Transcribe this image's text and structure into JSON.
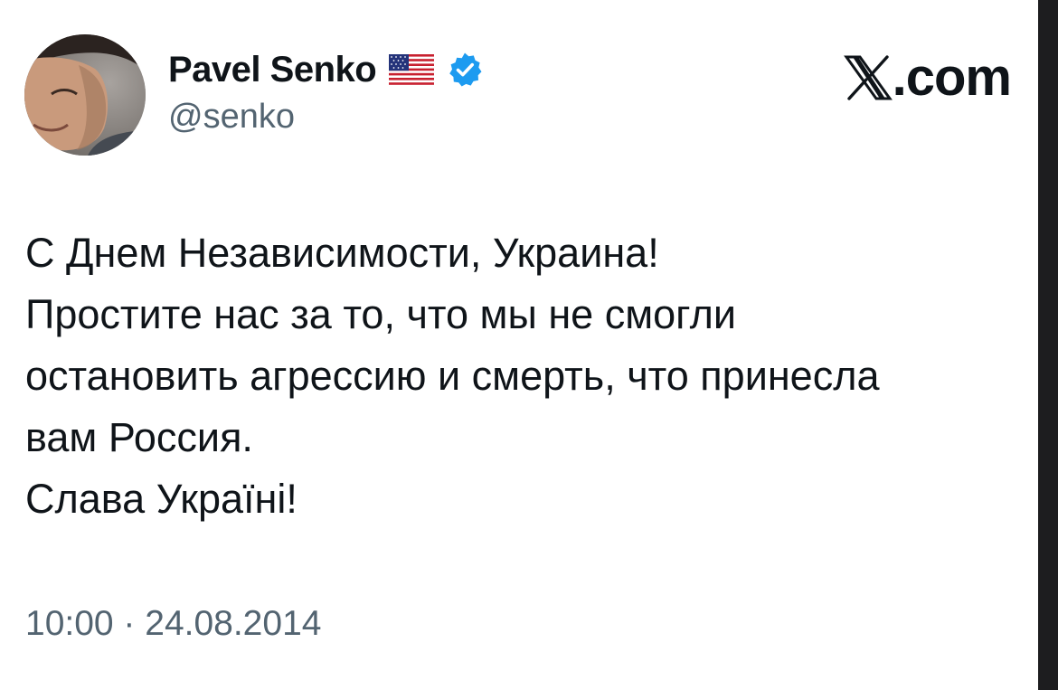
{
  "author": {
    "display_name": "Pavel Senko",
    "handle": "@senko",
    "flag_icon": "us-flag-icon",
    "verified_icon": "verified-badge-icon",
    "verified_color": "#1d9bf0"
  },
  "brand": {
    "logo_icon": "x-logo-icon",
    "suffix": ".com"
  },
  "tweet": {
    "lines": [
      "С Днем Независимости, Украина!",
      "Простите нас за то, что мы не смогли",
      "остановить агрессию и смерть, что принесла",
      "вам Россия.",
      "Слава Україні!"
    ],
    "timestamp": "10:00 · 24.08.2014"
  },
  "colors": {
    "text_primary": "#0f1419",
    "text_secondary": "#536471",
    "background": "#ffffff"
  }
}
